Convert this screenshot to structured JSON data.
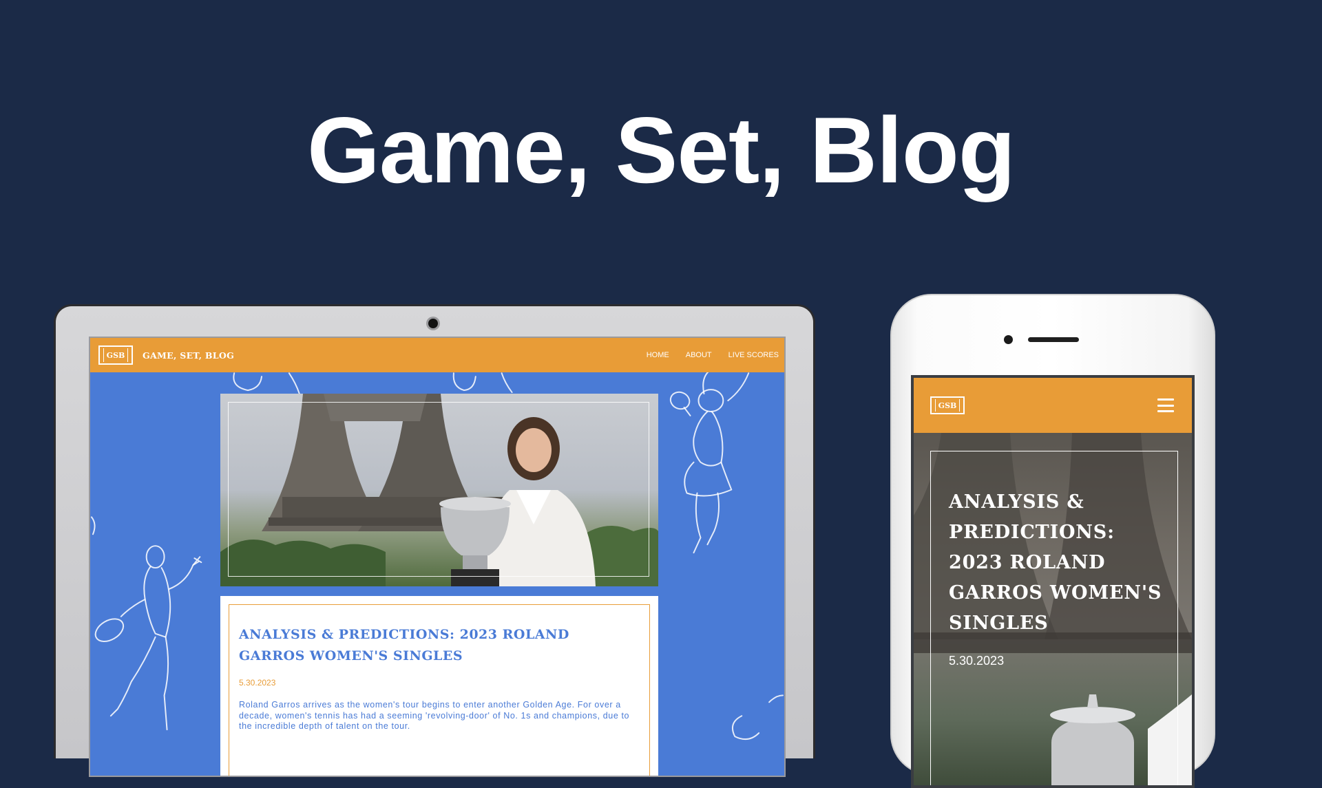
{
  "page": {
    "title": "Game, Set, Blog"
  },
  "desktop": {
    "logo_text": "GSB",
    "brand": "GAME, SET, BLOG",
    "nav": [
      {
        "label": "HOME"
      },
      {
        "label": "ABOUT"
      },
      {
        "label": "LIVE SCORES"
      }
    ],
    "article": {
      "title": "ANALYSIS & PREDICTIONS: 2023 ROLAND GARROS WOMEN'S SINGLES",
      "date": "5.30.2023",
      "excerpt": "Roland Garros arrives as the women's tour begins to enter another Golden Age. For over a decade, women's tennis has had a seeming 'revolving-door' of No. 1s and champions, due to the incredible depth of talent on the tour."
    }
  },
  "mobile": {
    "logo_text": "GSB",
    "menu_icon": "hamburger-icon",
    "article": {
      "title": "ANALYSIS & PREDICTIONS: 2023 ROLAND GARROS WOMEN'S SINGLES",
      "date": "5.30.2023"
    }
  },
  "colors": {
    "background": "#1b2a47",
    "header_orange": "#e89c37",
    "site_blue": "#4a7bd6"
  }
}
